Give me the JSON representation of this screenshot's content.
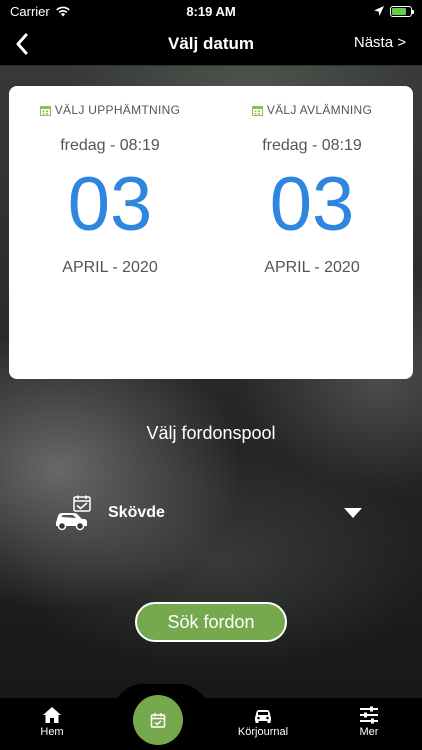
{
  "status_bar": {
    "carrier": "Carrier",
    "time": "8:19 AM",
    "battery_level": 0.75,
    "battery_color": "#5bd046"
  },
  "nav": {
    "back_icon": "chevron-left-icon",
    "title": "Välj datum",
    "next_label": "Nästa >"
  },
  "pickup": {
    "label": "VÄLJ UPPHÄMTNING",
    "time": "fredag - 08:19",
    "day": "03",
    "month_year": "APRIL - 2020"
  },
  "dropoff": {
    "label": "VÄLJ AVLÄMNING",
    "time": "fredag - 08:19",
    "day": "03",
    "month_year": "APRIL - 2020"
  },
  "vehicle_pool": {
    "heading": "Välj fordonspool",
    "selected": "Skövde",
    "icon": "car-calendar-icon"
  },
  "search_button": {
    "label": "Sök fordon"
  },
  "tabs": [
    {
      "label": "Hem",
      "icon": "home-icon"
    },
    {
      "label": "",
      "icon": "calendar-check-icon"
    },
    {
      "label": "Körjournal",
      "icon": "car-icon"
    },
    {
      "label": "Mer",
      "icon": "sliders-icon"
    }
  ],
  "colors": {
    "accent_green": "#76a84e",
    "date_blue": "#2e86de",
    "calendar_icon_green": "#8cc152"
  }
}
